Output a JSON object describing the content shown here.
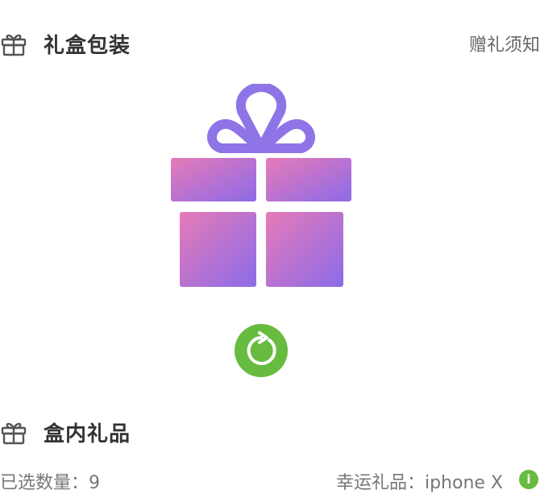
{
  "header_top": {
    "title": "礼盒包装",
    "link_label": "赠礼须知",
    "icon": "gift-icon"
  },
  "gift_preview": {
    "icon": "gift-box-icon",
    "colors": {
      "bow": "#8e74e6",
      "gradient_start": "#e77ab8",
      "gradient_end": "#8c6be8"
    }
  },
  "refresh": {
    "icon": "refresh-icon",
    "color": "#67bb3f"
  },
  "header_bottom": {
    "title": "盒内礼品",
    "icon": "gift-icon"
  },
  "summary": {
    "selected_count_label": "已选数量：9",
    "lucky_gift_label": "幸运礼品：iphone X",
    "info_icon": "info-icon",
    "info_glyph": "i"
  }
}
